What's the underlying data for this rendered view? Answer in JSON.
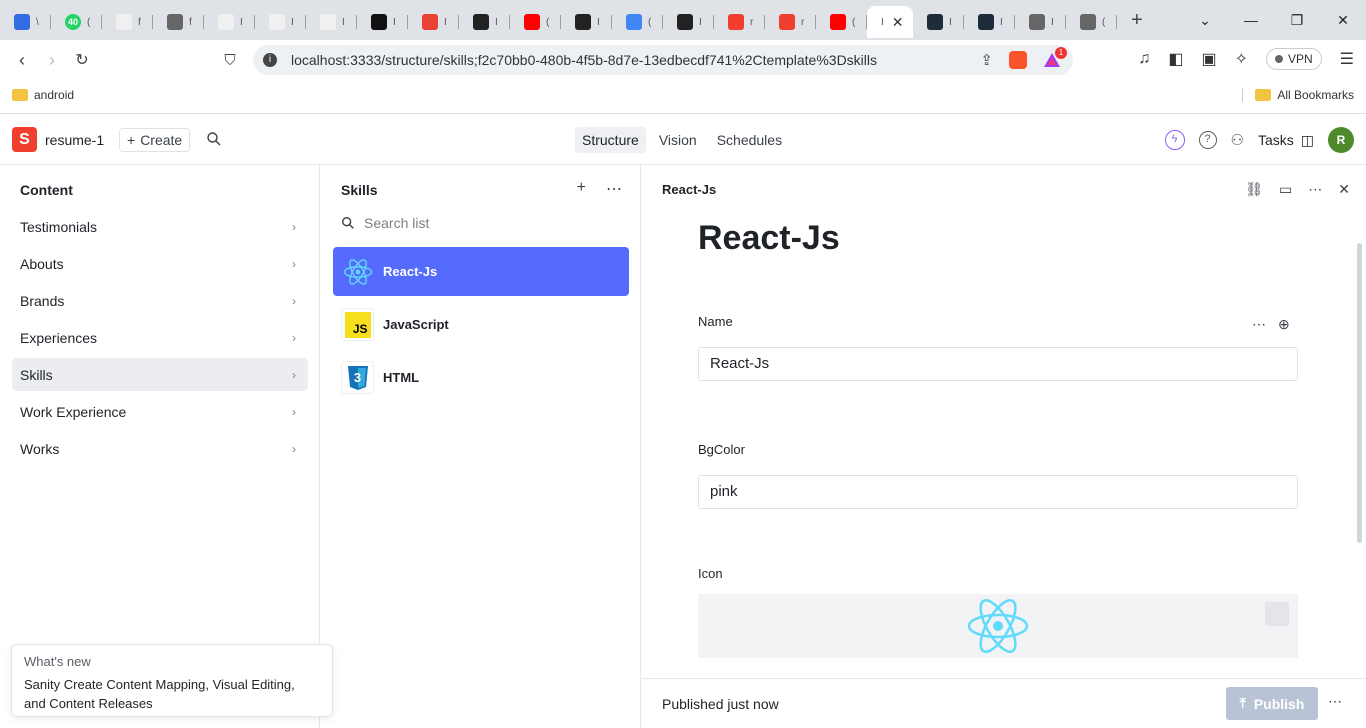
{
  "browser": {
    "tabs": [
      {
        "icon": "kubernetes-icon",
        "title": "\\",
        "color": "#326ce5"
      },
      {
        "icon": "whatsapp-icon",
        "title": "(",
        "color": "#25d366",
        "badge": "40"
      },
      {
        "icon": "next-icon",
        "title": "f",
        "color": "#f0f0f0"
      },
      {
        "icon": "globe-icon",
        "title": "f",
        "color": "#666"
      },
      {
        "icon": "next-icon",
        "title": "I",
        "color": "#f0f0f0"
      },
      {
        "icon": "next-icon",
        "title": "I",
        "color": "#f0f0f0"
      },
      {
        "icon": "next-icon",
        "title": "I",
        "color": "#f0f0f0"
      },
      {
        "icon": "hashnode-icon",
        "title": "I",
        "color": "#111"
      },
      {
        "icon": "gmail-icon",
        "title": "I",
        "color": "#ea4335"
      },
      {
        "icon": "github-icon",
        "title": "I",
        "color": "#222"
      },
      {
        "icon": "youtube-icon",
        "title": "(",
        "color": "#ff0000"
      },
      {
        "icon": "github-icon",
        "title": "I",
        "color": "#222"
      },
      {
        "icon": "google-icon",
        "title": "(",
        "color": "#4285f4"
      },
      {
        "icon": "github-icon",
        "title": "I",
        "color": "#222"
      },
      {
        "icon": "sanity-icon",
        "title": "r",
        "color": "#f03e2f"
      },
      {
        "icon": "sanity-icon",
        "title": "r",
        "color": "#f03e2f"
      },
      {
        "icon": "youtube-icon",
        "title": "(",
        "color": "#ff0000"
      },
      {
        "icon": "active-tab",
        "title": "I",
        "active": true
      },
      {
        "icon": "react-icon",
        "title": "I",
        "color": "#1e2b3a"
      },
      {
        "icon": "react-icon",
        "title": "I",
        "color": "#1e2b3a"
      },
      {
        "icon": "globe-icon",
        "title": "I",
        "color": "#666"
      },
      {
        "icon": "globe-icon",
        "title": "(",
        "color": "#666"
      }
    ],
    "url": "localhost:3333/structure/skills;f2c70bb0-480b-4f5b-8d7e-13edbecdf741%2Ctemplate%3Dskills",
    "rewards_badge": "1",
    "vpn_label": "VPN",
    "bookmarks": {
      "left": "android",
      "right": "All Bookmarks"
    }
  },
  "studio": {
    "project": "resume-1",
    "create_label": "Create",
    "tools": [
      "Structure",
      "Vision",
      "Schedules"
    ],
    "active_tool": "Structure",
    "tasks_label": "Tasks",
    "avatar_initial": "R"
  },
  "content_pane": {
    "title": "Content",
    "items": [
      "Testimonials",
      "Abouts",
      "Brands",
      "Experiences",
      "Skills",
      "Work Experience",
      "Works"
    ],
    "selected": "Skills"
  },
  "skills_pane": {
    "title": "Skills",
    "search_placeholder": "Search list",
    "items": [
      {
        "label": "React-Js",
        "icon": "react-icon",
        "selected": true
      },
      {
        "label": "JavaScript",
        "icon": "js-icon",
        "icon_text": "JS"
      },
      {
        "label": "HTML",
        "icon": "css3-icon",
        "icon_text": "3"
      }
    ]
  },
  "document": {
    "header_title": "React-Js",
    "title": "React-Js",
    "fields": {
      "name_label": "Name",
      "name_value": "React-Js",
      "bgcolor_label": "BgColor",
      "bgcolor_value": "pink",
      "icon_label": "Icon"
    },
    "status": "Published just now",
    "publish_label": "Publish"
  },
  "whats_new": {
    "title": "What's new",
    "body": "Sanity Create Content Mapping, Visual Editing, and Content Releases"
  },
  "colors": {
    "accent": "#556bfc",
    "sanity_red": "#f03e2f",
    "react_cyan": "#61dafb",
    "publish_disabled": "#b8c3d6"
  }
}
